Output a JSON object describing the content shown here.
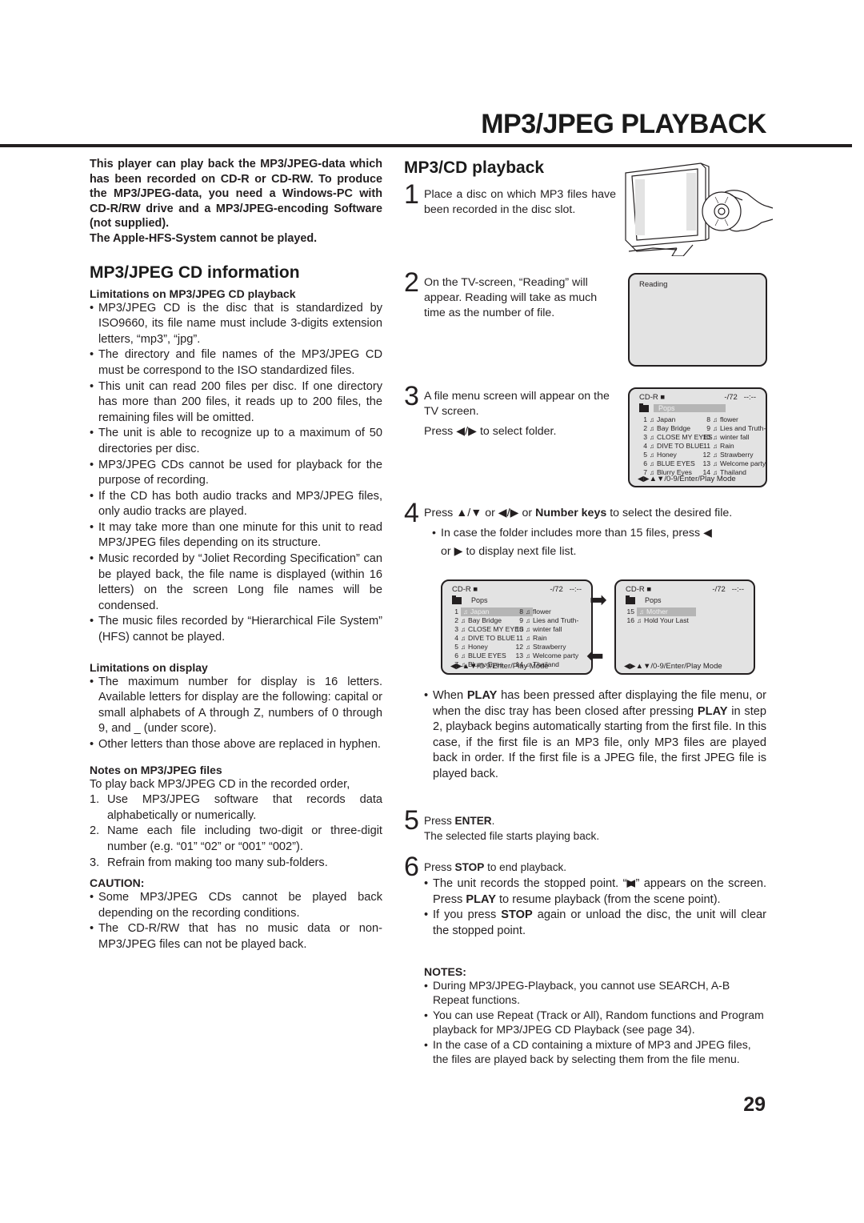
{
  "header": {
    "title": "MP3/JPEG PLAYBACK"
  },
  "left": {
    "intro": [
      "This player can play back the MP3/JPEG-data which has been recorded on CD-R or CD-RW. To produce the MP3/JPEG-data, you need a Windows-PC with CD-R/RW drive and a MP3/JPEG-encoding Software (not supplied).",
      "The Apple-HFS-System cannot be played."
    ],
    "info_title": "MP3/JPEG CD information",
    "limitations_title": "Limitations on MP3/JPEG CD playback",
    "limitations": [
      "MP3/JPEG CD is the disc that is standardized by ISO9660, its file name must include 3-digits extension letters, “mp3”, “jpg”.",
      "The directory and file names of the MP3/JPEG CD must be correspond to the ISO  standardized files.",
      "This unit can read 200 files per disc. If one directory has more than 200 files, it reads up to 200 files, the remaining files will be omitted.",
      "The unit is able to recognize up to a maximum of 50 directories per disc.",
      "MP3/JPEG CDs cannot be used for playback for the purpose of recording.",
      "If the CD has both audio tracks and MP3/JPEG files, only audio tracks are played.",
      "It may take more than one minute for this unit to read MP3/JPEG files depending on its structure.",
      "Music recorded by “Joliet Recording Specification” can be played back, the file name is displayed (within 16 letters) on the screen Long file names will be condensed.",
      "The music files recorded by “Hierarchical File System” (HFS) cannot be played."
    ],
    "display_title": "Limitations on display",
    "display": [
      "The maximum number for display is 16 letters. Available letters for display are the following: capital or small alphabets of A through Z, numbers of 0 through 9, and _ (under score).",
      "Other letters than those above are replaced in hyphen."
    ],
    "files_title": "Notes on MP3/JPEG files",
    "files_intro": "To play back MP3/JPEG CD in the recorded order,",
    "files_steps": [
      {
        "n": "1.",
        "text": "Use MP3/JPEG software that records data alphabetically or numerically."
      },
      {
        "n": "2.",
        "text": "Name each file including two-digit or three-digit number (e.g. “01” “02” or “001” “002”)."
      },
      {
        "n": "3.",
        "text": "Refrain from making too many sub-folders."
      }
    ],
    "caution_title": "CAUTION:",
    "caution": [
      "Some MP3/JPEG CDs cannot be played back depending on the recording conditions.",
      "The CD-R/RW that has no music data or non-MP3/JPEG files can not be played back."
    ]
  },
  "right": {
    "section_title": "MP3/CD playback",
    "step1": {
      "num": "1",
      "text": "Place a disc on which MP3 files have been recorded in the disc slot."
    },
    "step2": {
      "num": "2",
      "text": "On the TV-screen, “Reading” will appear. Reading will take as much time as the number of file."
    },
    "step3": {
      "num": "3",
      "text": "A file menu screen will appear on the TV screen.",
      "press": "Press",
      "slash": "/",
      "tail": "to select folder."
    },
    "step4": {
      "num": "4",
      "press": "Press",
      "or1": "or",
      "or2": "or",
      "number_keys": "Number keys",
      "tail": "to select the desired file.",
      "bullet_a": "In case the folder includes more than 15 files, press",
      "bullet_or": "or",
      "bullet_tail": "to display next file list.",
      "play_note_parts": [
        "When ",
        "PLAY",
        " has been pressed after displaying the file menu, or when the disc tray has been closed after pressing ",
        "PLAY",
        " in step 2, playback begins automatically starting from the first file.  In this case, if the first file is an MP3 file, only MP3 files are played back in order.  If the first file is a JPEG file, the first JPEG file is played back."
      ]
    },
    "step5": {
      "num": "5",
      "press": "Press ",
      "key": "ENTER",
      "end": ".",
      "text": "The selected file starts playing back."
    },
    "step6": {
      "num": "6",
      "press": "Press ",
      "key": "STOP",
      "tail": " to end playback.",
      "bullet1_parts": [
        "The unit records the stopped point. “",
        "”  appears on the screen. Press ",
        "PLAY",
        " to resume playback (from the scene point)."
      ],
      "bullet2_parts": [
        "If you press ",
        "STOP",
        " again or unload the disc, the unit will clear the stopped point."
      ]
    },
    "notes_title": "NOTES:",
    "notes": [
      "During MP3/JPEG-Playback, you cannot use SEARCH, A-B Repeat functions.",
      "You can use Repeat (Track or All), Random functions and Program playback for MP3/JPEG CD Playback (see page 34).",
      "In the case of a CD containing a mixture of MP3 and JPEG files, the files are played back by selecting them from the file menu."
    ]
  },
  "screens": {
    "reading": {
      "text": "Reading"
    },
    "menu": {
      "disc": "CD-R ■",
      "track": "-/72",
      "time": "--:--",
      "folder": "Pops",
      "footer": "◀▶▲▼/0-9/Enter/Play Mode",
      "files_col1": [
        {
          "n": "1",
          "name": "Japan"
        },
        {
          "n": "2",
          "name": "Bay Bridge"
        },
        {
          "n": "3",
          "name": "CLOSE MY EYES"
        },
        {
          "n": "4",
          "name": "DIVE TO BLUE"
        },
        {
          "n": "5",
          "name": "Honey"
        },
        {
          "n": "6",
          "name": "BLUE EYES"
        },
        {
          "n": "7",
          "name": "Blurry Eyes"
        }
      ],
      "files_col2": [
        {
          "n": "8",
          "name": "flower"
        },
        {
          "n": "9",
          "name": "Lies and Truth-"
        },
        {
          "n": "10",
          "name": "winter fall"
        },
        {
          "n": "11",
          "name": "Rain"
        },
        {
          "n": "12",
          "name": "Strawberry"
        },
        {
          "n": "13",
          "name": "Welcome party"
        },
        {
          "n": "14",
          "name": "Thailand"
        }
      ],
      "page2_files": [
        {
          "n": "15",
          "name": "Mother"
        },
        {
          "n": "16",
          "name": "Hold Your Last"
        }
      ]
    }
  },
  "page_number": "29"
}
